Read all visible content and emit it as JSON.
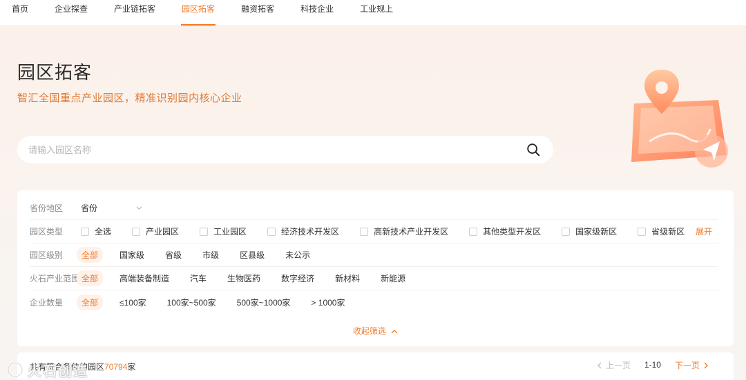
{
  "nav": {
    "items": [
      "首页",
      "企业探查",
      "产业链拓客",
      "园区拓客",
      "融资拓客",
      "科技企业",
      "工业规上"
    ],
    "active_index": 3
  },
  "hero": {
    "title": "园区拓客",
    "subtitle": "智汇全国重点产业园区，精准识别园内核心企业"
  },
  "search": {
    "placeholder": "请输入园区名称",
    "value": ""
  },
  "filters": {
    "province": {
      "label": "省份地区",
      "value": "省份"
    },
    "park_type": {
      "label": "园区类型",
      "options": [
        "全选",
        "产业园区",
        "工业园区",
        "经济技术开发区",
        "高新技术产业开发区",
        "其他类型开发区",
        "国家级新区",
        "省级新区"
      ],
      "expand_label": "展开"
    },
    "park_level": {
      "label": "园区级别",
      "all": "全部",
      "options": [
        "国家级",
        "省级",
        "市级",
        "区县级",
        "未公示"
      ]
    },
    "industry": {
      "label": "火石产业范围",
      "all": "全部",
      "options": [
        "高端装备制造",
        "汽车",
        "生物医药",
        "数字经济",
        "新材料",
        "新能源"
      ]
    },
    "company_count": {
      "label": "企业数量",
      "all": "全部",
      "options": [
        "≤100家",
        "100家~500家",
        "500家~1000家",
        "> 1000家"
      ]
    },
    "collapse_label": "收起筛选"
  },
  "results": {
    "prefix": "共有符合条件的园区",
    "count": "70794",
    "suffix": "家",
    "pager": {
      "prev": "上一页",
      "range": "1-10",
      "next": "下一页"
    }
  },
  "watermark": {
    "text": "火石创造"
  },
  "colors": {
    "accent": "#f07a2a",
    "subtitle": "#e27a34"
  }
}
